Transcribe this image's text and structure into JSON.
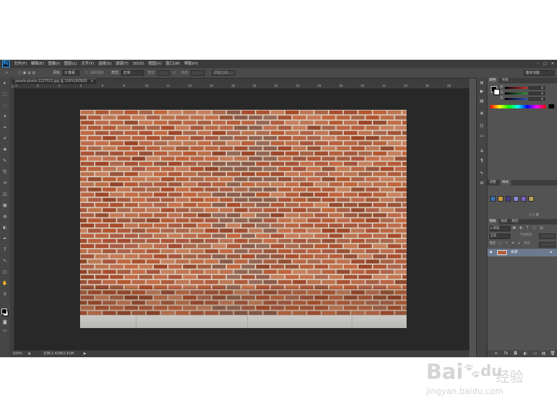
{
  "app": {
    "logo": "Ps",
    "menu": [
      "文件(F)",
      "编辑(E)",
      "图像(I)",
      "图层(L)",
      "文字(Y)",
      "选择(S)",
      "滤镜(T)",
      "3D(D)",
      "视图(V)",
      "窗口(W)",
      "帮助(H)"
    ],
    "window_buttons": [
      "–",
      "□",
      "✕"
    ]
  },
  "options_bar": {
    "feather_label": "羽化:",
    "feather_value": "0 像素",
    "antialias_label": "消除锯齿",
    "style_label": "样式:",
    "style_value": "正常",
    "width_label": "宽度:",
    "height_label": "高度:",
    "refine_edge": "调整边缘...",
    "workspace": "基本功能"
  },
  "document": {
    "tab_title": "pexels-photo-1227515.jpg @ 100%(RGB/8)",
    "tab_close": "×",
    "ruler_numbers": [
      "2",
      "0",
      "2",
      "4",
      "6",
      "8",
      "10",
      "12",
      "14",
      "16",
      "18",
      "20",
      "22",
      "24",
      "26",
      "28",
      "30",
      "32",
      "34",
      "36",
      "38"
    ],
    "colors": {
      "brick": "#b05a3a",
      "mortar": "#d9c9b8",
      "sidewalk": "#c3c2bf"
    }
  },
  "status": {
    "zoom": "100%",
    "doc_info": "文档:2.41M/2.41M",
    "arrow": "▶"
  },
  "tools": [
    "move-tool",
    "marquee-tool",
    "lasso-tool",
    "quick-select-tool",
    "crop-tool",
    "eyedropper-tool",
    "healing-tool",
    "brush-tool",
    "stamp-tool",
    "history-brush-tool",
    "eraser-tool",
    "gradient-tool",
    "blur-tool",
    "dodge-tool",
    "pen-tool",
    "type-tool",
    "path-select-tool",
    "shape-tool",
    "hand-tool",
    "zoom-tool"
  ],
  "panels": {
    "color_tabs": [
      "颜色",
      "色板"
    ],
    "rgb": [
      {
        "label": "R",
        "value": "0",
        "color": "#c4302b"
      },
      {
        "label": "G",
        "value": "0",
        "color": "#2f9a3b"
      },
      {
        "label": "B",
        "value": "0",
        "color": "#2d4fbf"
      }
    ],
    "adjust_tabs": [
      "调整",
      "样式"
    ],
    "layers_tabs": [
      "图层",
      "通道",
      "路径"
    ],
    "kind_label": "ρ 类型",
    "blend_mode": "正常",
    "opacity_label": "不透明度:",
    "lock_label": "锁定:",
    "fill_label": "填充:",
    "layer_name": "背景",
    "layer_lock_icon": "lock-icon"
  },
  "watermark": {
    "brand": "Bai",
    "brand_suffix": "du",
    "cn_text": "经验",
    "url": "jingyan.baidu.com"
  }
}
